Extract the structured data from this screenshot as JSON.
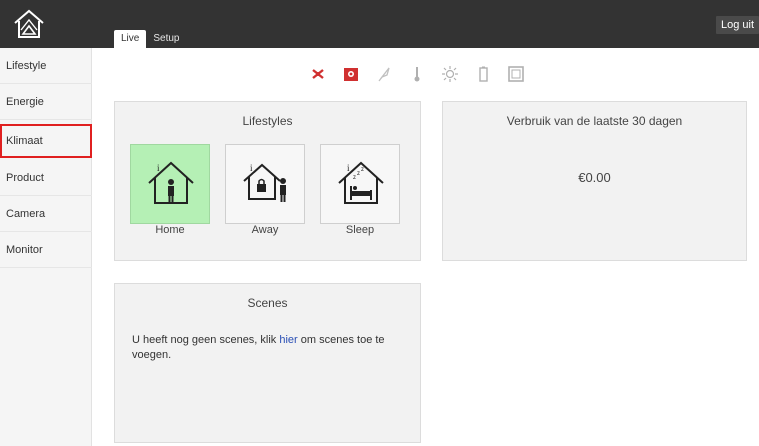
{
  "header": {
    "tabs": [
      {
        "label": "Live",
        "active": true
      },
      {
        "label": "Setup",
        "active": false
      }
    ],
    "logout_label": "Log uit"
  },
  "sidebar": {
    "items": [
      {
        "label": "Lifestyle"
      },
      {
        "label": "Energie"
      },
      {
        "label": "Klimaat",
        "highlighted": true
      },
      {
        "label": "Product"
      },
      {
        "label": "Camera"
      },
      {
        "label": "Monitor"
      }
    ]
  },
  "status_icons": [
    "x-signal-icon",
    "alarm-box-icon",
    "feather-icon",
    "thermometer-icon",
    "sun-icon",
    "battery-icon",
    "window-icon"
  ],
  "lifestyles": {
    "title": "Lifestyles",
    "options": [
      {
        "label": "Home",
        "active": true
      },
      {
        "label": "Away",
        "active": false
      },
      {
        "label": "Sleep",
        "active": false
      }
    ]
  },
  "consumption": {
    "title": "Verbruik van de laatste 30 dagen",
    "amount": "€0.00"
  },
  "scenes": {
    "title": "Scenes",
    "text_before": "U heeft nog geen scenes, klik ",
    "link_label": "hier",
    "text_after": " om scenes toe te voegen."
  },
  "colors": {
    "topbar": "#333333",
    "active_lifestyle": "#b5f0b5",
    "highlight_outline": "#e02020",
    "link": "#2a4fb5"
  }
}
